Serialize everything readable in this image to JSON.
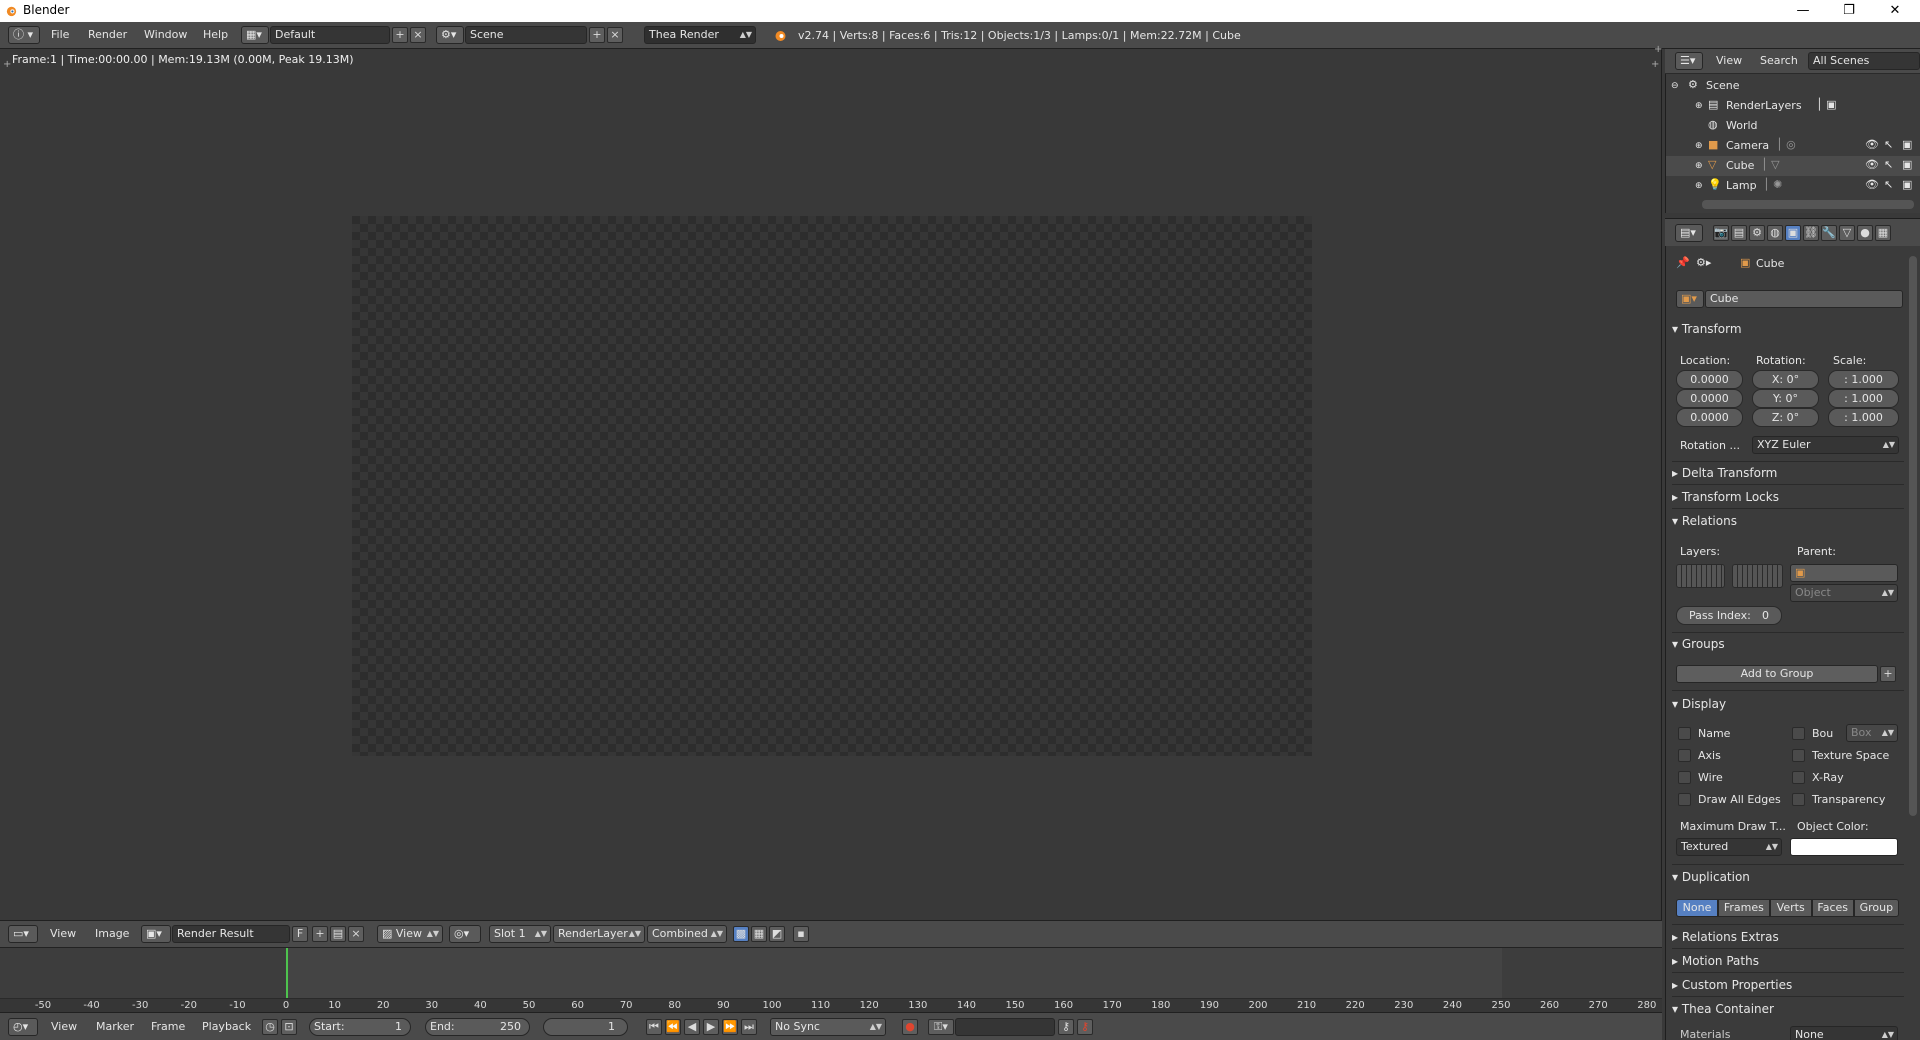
{
  "window": {
    "title": "Blender",
    "min": "—",
    "max": "❐",
    "close": "✕"
  },
  "info_header": {
    "menus": [
      "File",
      "Render",
      "Window",
      "Help"
    ],
    "layout": "Default",
    "scene": "Scene",
    "engine": "Thea Render",
    "stats": "v2.74 | Verts:8 | Faces:6 | Tris:12 | Objects:1/3 | Lamps:0/1 | Mem:22.72M | Cube"
  },
  "image_editor": {
    "info": "Frame:1 | Time:00:00.00 | Mem:19.13M (0.00M, Peak 19.13M)",
    "header": {
      "view": "View",
      "image": "Image",
      "image_name": "Render Result",
      "fake_user": "F",
      "view_mode": "View",
      "slot": "Slot 1",
      "render_layer": "RenderLayer",
      "pass": "Combined"
    }
  },
  "timeline": {
    "ticks": [
      "-50",
      "-40",
      "-30",
      "-20",
      "-10",
      "0",
      "10",
      "20",
      "30",
      "40",
      "50",
      "60",
      "70",
      "80",
      "90",
      "100",
      "110",
      "120",
      "130",
      "140",
      "150",
      "160",
      "170",
      "180",
      "190",
      "200",
      "210",
      "220",
      "230",
      "240",
      "250",
      "260",
      "270",
      "280"
    ],
    "current_frame": 1,
    "header": {
      "view": "View",
      "marker": "Marker",
      "frame": "Frame",
      "playback": "Playback",
      "start_label": "Start:",
      "start": "1",
      "end_label": "End:",
      "end": "250",
      "frame_value": "1",
      "sync": "No Sync"
    }
  },
  "outliner": {
    "menus": {
      "view": "View",
      "search": "Search",
      "filter": "All Scenes"
    },
    "items": [
      {
        "label": "Scene"
      },
      {
        "label": "RenderLayers"
      },
      {
        "label": "World"
      },
      {
        "label": "Camera"
      },
      {
        "label": "Cube"
      },
      {
        "label": "Lamp"
      }
    ]
  },
  "properties": {
    "breadcrumb": "Cube",
    "object_name": "Cube",
    "transform": {
      "title": "Transform",
      "location_label": "Location:",
      "rotation_label": "Rotation:",
      "scale_label": "Scale:",
      "location": [
        "0.0000",
        "0.0000",
        "0.0000"
      ],
      "rotation": [
        "X: 0°",
        "Y: 0°",
        "Z: 0°"
      ],
      "scale": [
        ": 1.000",
        ": 1.000",
        ": 1.000"
      ],
      "rotation_mode_label": "Rotation ...",
      "rotation_mode": "XYZ Euler"
    },
    "panels_collapsed_a": [
      "Delta Transform",
      "Transform Locks"
    ],
    "relations": {
      "title": "Relations",
      "layers_label": "Layers:",
      "parent_label": "Parent:",
      "parent_type": "Object",
      "pass_index_label": "Pass Index:",
      "pass_index": "0"
    },
    "groups": {
      "title": "Groups",
      "add": "Add to Group"
    },
    "display": {
      "title": "Display",
      "left": [
        "Name",
        "Axis",
        "Wire",
        "Draw All Edges"
      ],
      "right": [
        "Bou",
        "Texture Space",
        "X-Ray",
        "Transparency"
      ],
      "bounds_type": "Box",
      "max_draw_label": "Maximum Draw T...",
      "max_draw": "Textured",
      "color_label": "Object Color:"
    },
    "duplication": {
      "title": "Duplication",
      "options": [
        "None",
        "Frames",
        "Verts",
        "Faces",
        "Group"
      ]
    },
    "panels_collapsed_b": [
      "Relations Extras",
      "Motion Paths",
      "Custom Properties"
    ],
    "thea": {
      "title": "Thea Container",
      "label": "Materials",
      "value": "None"
    }
  },
  "colors": {
    "accent": "#5680c2",
    "frame_cursor": "#4ec34e"
  }
}
